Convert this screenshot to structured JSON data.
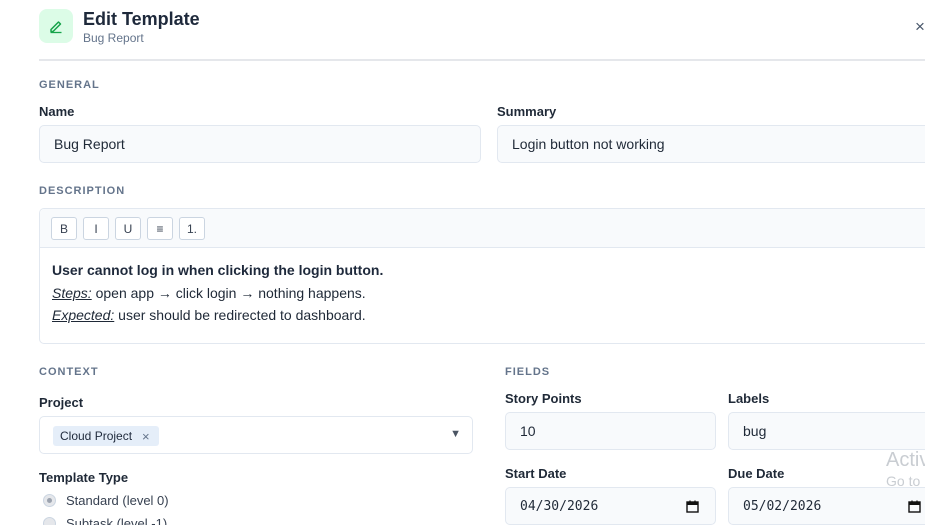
{
  "header": {
    "title": "Edit Template",
    "subtitle": "Bug Report",
    "icon": "pencil-icon",
    "close_label": "×"
  },
  "general": {
    "section_label": "GENERAL",
    "name_label": "Name",
    "name_value": "Bug Report",
    "summary_label": "Summary",
    "summary_value": "Login button not working"
  },
  "description": {
    "section_label": "DESCRIPTION",
    "toolbar": [
      "B",
      "I",
      "U",
      "≡",
      "1."
    ],
    "content": {
      "line1": "User cannot log in when clicking the login button.",
      "steps_label": "Steps:",
      "steps_text": " open app → click login → nothing happens.",
      "expected_label": "Expected:",
      "expected_text": " user should be redirected to dashboard."
    }
  },
  "context": {
    "section_label": "CONTEXT",
    "project_label": "Project",
    "project_chip": "Cloud Project",
    "chip_remove": "×",
    "template_type_label": "Template Type",
    "template_types": [
      {
        "label": "Standard (level 0)",
        "checked": true
      },
      {
        "label": "Subtask (level -1)",
        "checked": false
      }
    ]
  },
  "fields": {
    "section_label": "FIELDS",
    "story_points_label": "Story Points",
    "story_points_value": "10",
    "labels_label": "Labels",
    "labels_value": "bug",
    "start_date_label": "Start Date",
    "start_date_value": "04/30/2026",
    "due_date_label": "Due Date",
    "due_date_value": "05/02/2026"
  },
  "watermark": {
    "line1": "Activ",
    "line2": "Go to"
  },
  "colors": {
    "icon_bg": "#dcfce7",
    "icon_fg": "#16a34a",
    "input_bg": "#f8fafc",
    "border": "#e2e8f0",
    "chip_bg": "#e5eef9"
  }
}
